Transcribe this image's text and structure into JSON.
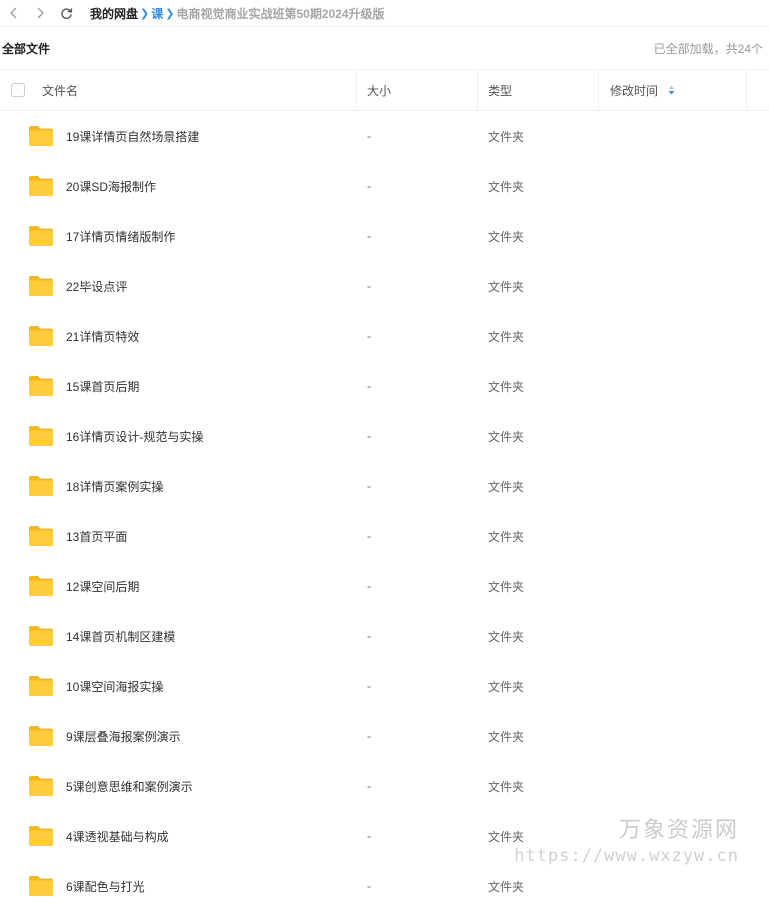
{
  "breadcrumb": {
    "root": "我的网盘",
    "parent": "课",
    "current": "电商视觉商业实战班第50期2024升级版"
  },
  "header": {
    "title": "全部文件",
    "status": "已全部加载，共24个"
  },
  "columns": {
    "name": "文件名",
    "size": "大小",
    "type": "类型",
    "modified": "修改时间"
  },
  "icons": {
    "back": "chevron-left-icon",
    "forward": "chevron-right-icon",
    "refresh": "refresh-icon",
    "folder": "folder-icon",
    "sort": "sort-icon"
  },
  "colors": {
    "accent": "#3a8ee6",
    "folder": "#ffc933"
  },
  "rows": [
    {
      "name": "19课详情页自然场景搭建",
      "size": "-",
      "type": "文件夹"
    },
    {
      "name": "20课SD海报制作",
      "size": "-",
      "type": "文件夹"
    },
    {
      "name": "17详情页情绪版制作",
      "size": "-",
      "type": "文件夹"
    },
    {
      "name": "22毕设点评",
      "size": "-",
      "type": "文件夹"
    },
    {
      "name": "21详情页特效",
      "size": "-",
      "type": "文件夹"
    },
    {
      "name": "15课首页后期",
      "size": "-",
      "type": "文件夹"
    },
    {
      "name": "16详情页设计-规范与实操",
      "size": "-",
      "type": "文件夹"
    },
    {
      "name": "18详情页案例实操",
      "size": "-",
      "type": "文件夹"
    },
    {
      "name": "13首页平面",
      "size": "-",
      "type": "文件夹"
    },
    {
      "name": "12课空间后期",
      "size": "-",
      "type": "文件夹"
    },
    {
      "name": "14课首页机制区建模",
      "size": "-",
      "type": "文件夹"
    },
    {
      "name": "10课空间海报实操",
      "size": "-",
      "type": "文件夹"
    },
    {
      "name": "9课层叠海报案例演示",
      "size": "-",
      "type": "文件夹"
    },
    {
      "name": "5课创意思维和案例演示",
      "size": "-",
      "type": "文件夹"
    },
    {
      "name": "4课透视基础与构成",
      "size": "-",
      "type": "文件夹"
    },
    {
      "name": "6课配色与打光",
      "size": "-",
      "type": "文件夹"
    }
  ],
  "watermark": {
    "title": "万象资源网",
    "url": "https://www.wxzyw.cn"
  }
}
